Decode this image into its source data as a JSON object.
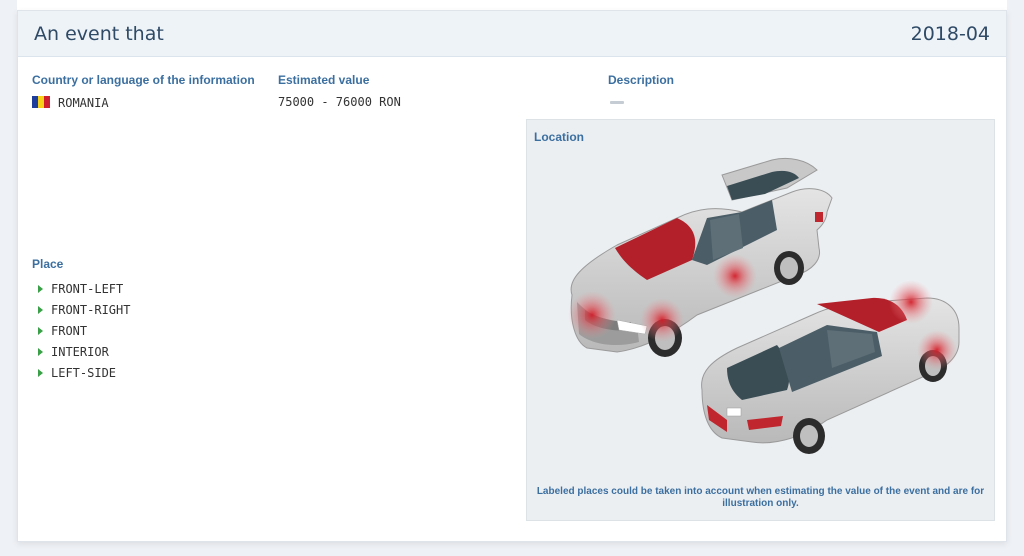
{
  "header": {
    "title": "An event that",
    "date": "2018-04"
  },
  "country": {
    "label": "Country or language of the information",
    "value": "ROMANIA",
    "flag_colors": [
      "#1f3d9a",
      "#f7d117",
      "#cf1f2e"
    ]
  },
  "estimate": {
    "label": "Estimated value",
    "value": "75000 - 76000 RON"
  },
  "description": {
    "label": "Description",
    "value": "—"
  },
  "place": {
    "label": "Place",
    "items": [
      "FRONT-LEFT",
      "FRONT-RIGHT",
      "FRONT",
      "INTERIOR",
      "LEFT-SIDE"
    ]
  },
  "location": {
    "label": "Location",
    "note": "Labeled places could be taken into account when estimating the value of the event and are for illustration only.",
    "damage_color": "#c0262d"
  },
  "colors": {
    "accent": "#3b6fa0",
    "title": "#2f4a66",
    "bullet": "#3aa047"
  }
}
